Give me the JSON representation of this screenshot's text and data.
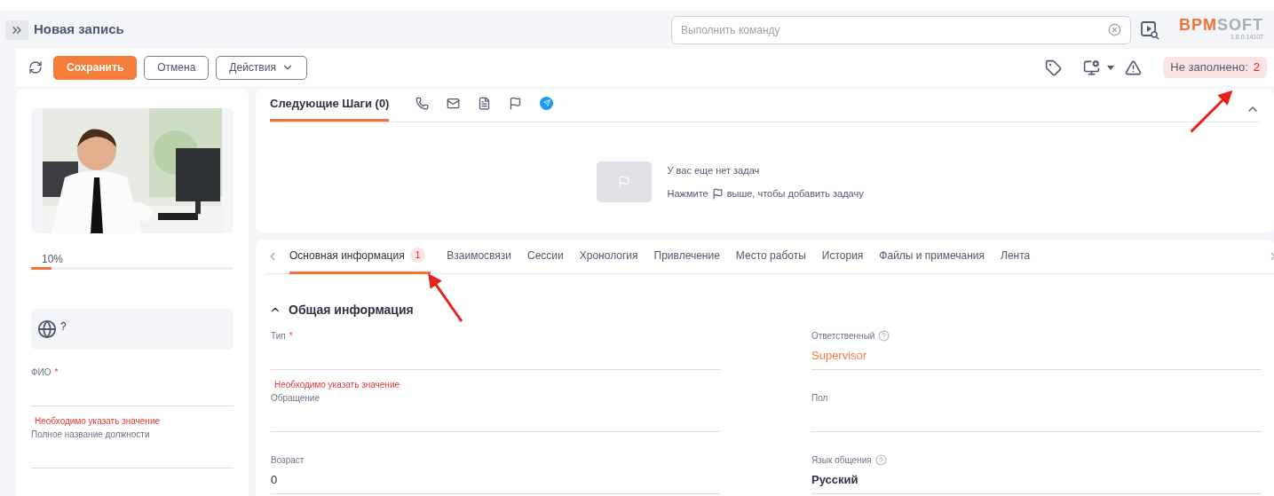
{
  "header": {
    "title": "Новая запись",
    "command_search": {
      "placeholder": "Выполнить команду"
    },
    "logo": {
      "brand_accent": "BPM",
      "brand_rest": "SOFT",
      "version": "1.8.0.14107"
    }
  },
  "toolbar": {
    "buttons": [
      {
        "label": "Сохранить",
        "kind": "primary"
      },
      {
        "label": "Отмена",
        "kind": "outline"
      },
      {
        "label": "Действия",
        "kind": "dropdown"
      }
    ],
    "unfilled": {
      "label": "Не заполнено:",
      "count": "2"
    }
  },
  "profile": {
    "completeness": {
      "reading": "10%",
      "level": 0.1
    },
    "language_mark": "?",
    "fields": [
      {
        "label": "ФИО",
        "required_mark": "*",
        "error": "Необходимо указать значение"
      },
      {
        "label": "Полное название должности"
      }
    ]
  },
  "next_steps": {
    "tabs": [
      {
        "label": "Следующие Шаги (0)",
        "selected": true
      }
    ],
    "expanded": true,
    "empty_state": {
      "title": "У вас еще нет задач",
      "hint_before": "Нажмите",
      "hint_after": "выше, чтобы добавить задачу"
    }
  },
  "detail_tabs": [
    {
      "label": "Основная информация",
      "badge": "1",
      "selected": true
    },
    {
      "label": "Взаимосвязи",
      "selected": false
    },
    {
      "label": "Сессии",
      "selected": false
    },
    {
      "label": "Хронология",
      "selected": false
    },
    {
      "label": "Привлечение",
      "selected": false
    },
    {
      "label": "Место работы",
      "selected": false
    },
    {
      "label": "История",
      "selected": false
    },
    {
      "label": "Файлы и примечания",
      "selected": false
    },
    {
      "label": "Лента",
      "selected": false
    }
  ],
  "section": {
    "title": "Общая информация",
    "expanded": true,
    "left_fields": [
      {
        "label": "Тип",
        "required_mark": "*",
        "error": "Необходимо указать значение"
      },
      {
        "label": "Обращение"
      },
      {
        "label": "Возраст",
        "value": "0",
        "kind": "text"
      }
    ],
    "right_fields": [
      {
        "label": "Ответственный",
        "help": true,
        "value": "Supervisor",
        "kind": "link"
      },
      {
        "label": "Пол"
      },
      {
        "label": "Язык общения",
        "help": true,
        "value": "Русский",
        "kind": "bold"
      }
    ]
  }
}
